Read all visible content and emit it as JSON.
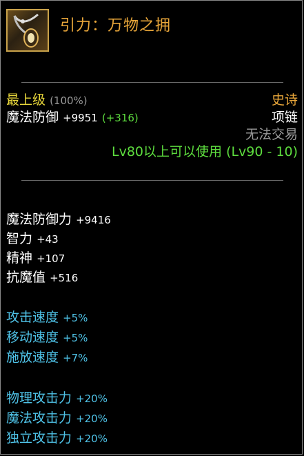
{
  "item": {
    "name": "引力：万物之拥",
    "grade_label": "最上级",
    "grade_pct": "(100%)",
    "rarity": "史诗",
    "slot": "项链",
    "defense_label": "魔法防御",
    "defense_value": "+9951",
    "defense_bonus": "(+316)",
    "trade": "无法交易",
    "level_req": "Lv80以上可以使用 (Lv90 - 10)",
    "icon": "necklace-icon"
  },
  "stats": [
    {
      "label": "魔法防御力",
      "value": "+9416"
    },
    {
      "label": "智力",
      "value": "+43"
    },
    {
      "label": "精神",
      "value": "+107"
    },
    {
      "label": "抗魔值",
      "value": "+516"
    }
  ],
  "speed_stats": [
    {
      "label": "攻击速度",
      "value": "+5%"
    },
    {
      "label": "移动速度",
      "value": "+5%"
    },
    {
      "label": "施放速度",
      "value": "+7%"
    }
  ],
  "attack_stats": [
    {
      "label": "物理攻击力",
      "value": "+20%"
    },
    {
      "label": "魔法攻击力",
      "value": "+20%"
    },
    {
      "label": "独立攻击力",
      "value": "+20%"
    }
  ],
  "colors": {
    "title": "#e8a63a",
    "grade": "#e7d63a",
    "level_req": "#5ddc3e",
    "bonus": "#5ddc3e",
    "special": "#4fc3e8"
  }
}
